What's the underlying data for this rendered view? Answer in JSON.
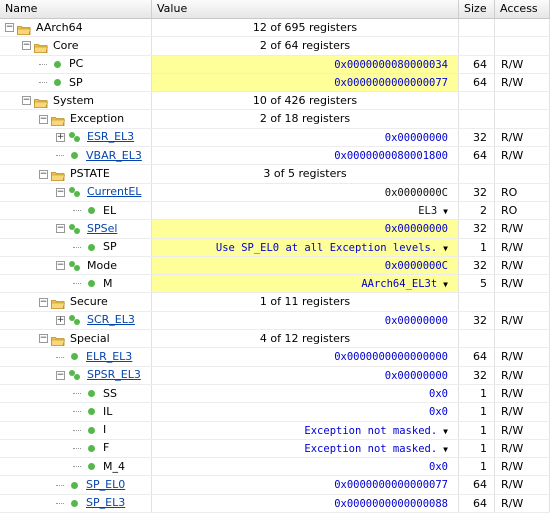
{
  "columns": {
    "name": "Name",
    "value": "Value",
    "size": "Size",
    "access": "Access"
  },
  "rows": [
    {
      "indent": 0,
      "kind": "group",
      "expander": "−",
      "name": "AArch64",
      "value": "12 of 695 registers",
      "style": "sum"
    },
    {
      "indent": 1,
      "kind": "group",
      "expander": "−",
      "name": "Core",
      "value": "2 of 64 registers",
      "style": "sum"
    },
    {
      "indent": 2,
      "kind": "leaf",
      "name": "PC",
      "value": "0x0000000080000034",
      "size": "64",
      "access": "R/W",
      "hl": true
    },
    {
      "indent": 2,
      "kind": "leaf",
      "name": "SP",
      "value": "0x0000000000000077",
      "size": "64",
      "access": "R/W",
      "hl": true
    },
    {
      "indent": 1,
      "kind": "group",
      "expander": "−",
      "name": "System",
      "value": "10 of 426 registers",
      "style": "sum"
    },
    {
      "indent": 2,
      "kind": "group",
      "expander": "−",
      "name": "Exception",
      "value": "2 of 18 registers",
      "style": "sum"
    },
    {
      "indent": 3,
      "kind": "pair",
      "expander": "+",
      "name": "ESR_EL3",
      "link": true,
      "value": "0x00000000",
      "size": "32",
      "access": "R/W"
    },
    {
      "indent": 3,
      "kind": "leaf",
      "name": "VBAR_EL3",
      "link": true,
      "value": "0x0000000080001800",
      "size": "64",
      "access": "R/W"
    },
    {
      "indent": 2,
      "kind": "group",
      "expander": "−",
      "name": "PSTATE",
      "value": "3 of 5 registers",
      "style": "sum"
    },
    {
      "indent": 3,
      "kind": "pair",
      "expander": "−",
      "name": "CurrentEL",
      "link": true,
      "value": "0x0000000C",
      "size": "32",
      "access": "RO",
      "style": "black"
    },
    {
      "indent": 4,
      "kind": "leaf",
      "name": "EL",
      "value": "EL3",
      "dropdown": true,
      "size": "2",
      "access": "RO",
      "style": "black"
    },
    {
      "indent": 3,
      "kind": "pair",
      "expander": "−",
      "name": "SPSel",
      "link": true,
      "value": "0x00000000",
      "size": "32",
      "access": "R/W",
      "hl": true
    },
    {
      "indent": 4,
      "kind": "leaf",
      "name": "SP",
      "value": "Use SP_EL0 at all Exception levels.",
      "dropdown": true,
      "size": "1",
      "access": "R/W",
      "hl": true
    },
    {
      "indent": 3,
      "kind": "pair",
      "expander": "−",
      "name": "Mode",
      "value": "0x0000000C",
      "size": "32",
      "access": "R/W",
      "hl": true
    },
    {
      "indent": 4,
      "kind": "leaf",
      "name": "M",
      "value": "AArch64_EL3t",
      "dropdown": true,
      "size": "5",
      "access": "R/W",
      "hl": true
    },
    {
      "indent": 2,
      "kind": "group",
      "expander": "−",
      "name": "Secure",
      "value": "1 of 11 registers",
      "style": "sum"
    },
    {
      "indent": 3,
      "kind": "pair",
      "expander": "+",
      "name": "SCR_EL3",
      "link": true,
      "value": "0x00000000",
      "size": "32",
      "access": "R/W"
    },
    {
      "indent": 2,
      "kind": "group",
      "expander": "−",
      "name": "Special",
      "value": "4 of 12 registers",
      "style": "sum"
    },
    {
      "indent": 3,
      "kind": "leaf",
      "name": "ELR_EL3",
      "link": true,
      "value": "0x0000000000000000",
      "size": "64",
      "access": "R/W"
    },
    {
      "indent": 3,
      "kind": "pair",
      "expander": "−",
      "name": "SPSR_EL3",
      "link": true,
      "value": "0x00000000",
      "size": "32",
      "access": "R/W"
    },
    {
      "indent": 4,
      "kind": "leaf",
      "name": "SS",
      "value": "0x0",
      "size": "1",
      "access": "R/W"
    },
    {
      "indent": 4,
      "kind": "leaf",
      "name": "IL",
      "value": "0x0",
      "size": "1",
      "access": "R/W"
    },
    {
      "indent": 4,
      "kind": "leaf",
      "name": "I",
      "value": "Exception not masked.",
      "dropdown": true,
      "size": "1",
      "access": "R/W"
    },
    {
      "indent": 4,
      "kind": "leaf",
      "name": "F",
      "value": "Exception not masked.",
      "dropdown": true,
      "size": "1",
      "access": "R/W"
    },
    {
      "indent": 4,
      "kind": "leaf",
      "name": "M_4",
      "value": "0x0",
      "size": "1",
      "access": "R/W"
    },
    {
      "indent": 3,
      "kind": "leaf",
      "name": "SP_EL0",
      "link": true,
      "value": "0x0000000000000077",
      "size": "64",
      "access": "R/W"
    },
    {
      "indent": 3,
      "kind": "leaf",
      "name": "SP_EL3",
      "link": true,
      "value": "0x0000000000000088",
      "size": "64",
      "access": "R/W"
    }
  ],
  "colors": {
    "highlight": "#ffff99",
    "value_blue": "#0000d4",
    "link": "#0645ad",
    "bullet": "#55b84a",
    "folder": "#f0c24a"
  }
}
